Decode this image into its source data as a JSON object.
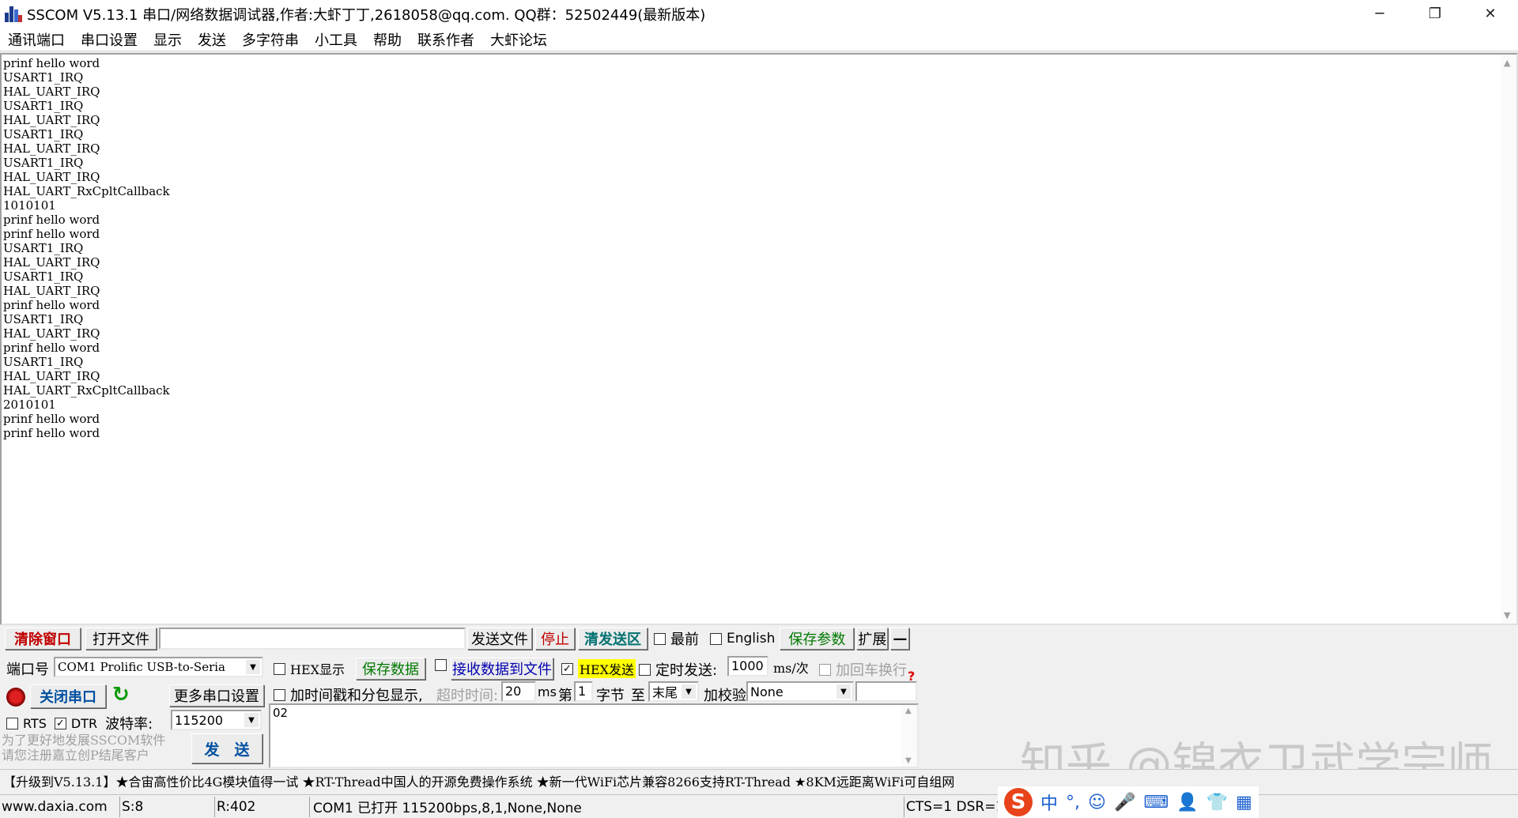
{
  "window": {
    "title": "SSCOM V5.13.1 串口/网络数据调试器,作者:大虾丁丁,2618058@qq.com. QQ群：52502449(最新版本)",
    "controls": [
      "─",
      "❐",
      "✕"
    ]
  },
  "menu": [
    "通讯端口",
    "串口设置",
    "显示",
    "发送",
    "多字符串",
    "小工具",
    "帮助",
    "联系作者",
    "大虾论坛"
  ],
  "receive": {
    "lines": [
      "prinf hello word",
      "USART1_IRQ",
      "HAL_UART_IRQ",
      "USART1_IRQ",
      "HAL_UART_IRQ",
      "USART1_IRQ",
      "HAL_UART_IRQ",
      "USART1_IRQ",
      "HAL_UART_IRQ",
      "HAL_UART_RxCpltCallback",
      "1010101",
      "prinf hello word",
      "prinf hello word",
      "USART1_IRQ",
      "HAL_UART_IRQ",
      "USART1_IRQ",
      "HAL_UART_IRQ",
      "prinf hello word",
      "USART1_IRQ",
      "HAL_UART_IRQ",
      "prinf hello word",
      "USART1_IRQ",
      "HAL_UART_IRQ",
      "HAL_UART_RxCpltCallback",
      "2010101",
      "prinf hello word",
      "prinf hello word"
    ]
  },
  "toolbar": {
    "clear": "清除窗口",
    "open_file": "打开文件",
    "file_path": "",
    "send_file": "发送文件",
    "stop": "停止",
    "clear_send": "清发送区",
    "top_most": "最前",
    "english": "English",
    "save_params": "保存参数",
    "expand": "扩展",
    "collapse": "—"
  },
  "port": {
    "port_label": "端口号",
    "port_value": "COM1 Prolific USB-to-Seria",
    "close_port": "关闭串口",
    "more_settings": "更多串口设置",
    "rts": "RTS",
    "dtr": "DTR",
    "baud_label": "波特率:",
    "baud_value": "115200"
  },
  "options": {
    "hex_display": "HEX显示",
    "save_data": "保存数据",
    "recv_to_file": "接收数据到文件",
    "hex_send": "HEX发送",
    "timed_send": "定时发送:",
    "interval": "1000",
    "interval_unit": "ms/次",
    "add_crlf": "加回车换行",
    "timestamp": "加时间戳和分包显示,",
    "timeout_label": "超时时间:",
    "timeout_value": "20",
    "timeout_unit": "ms",
    "nth": "第",
    "byte_index": "1",
    "byte_label": "字节",
    "to_label": "至",
    "to_value": "末尾",
    "checksum_label": "加校验",
    "checksum_value": "None"
  },
  "send": {
    "text": "02",
    "button": "发　送",
    "promo_line1": "为了更好地发展SSCOM软件",
    "promo_line2": "请您注册嘉立创P结尾客户"
  },
  "ticker": "【升级到V5.13.1】★合宙高性价比4G模块值得一试 ★RT-Thread中国人的开源免费操作系统 ★新一代WiFi芯片兼容8266支持RT-Thread ★8KM远距离WiFi可自组网",
  "status": {
    "site": "www.daxia.com",
    "sent": "S:8",
    "received": "R:402",
    "port_state": "COM1 已打开  115200bps,8,1,None,None",
    "lines": "CTS=1 DSR=1"
  },
  "watermark": "知乎 @锦衣卫武学宗师",
  "ime": {
    "logo": "S",
    "icons": [
      "中",
      "°,",
      "☺",
      "🎤",
      "⌨",
      "👤",
      "👕",
      "▦"
    ]
  },
  "colors": {
    "accent_red": "#c00000",
    "accent_teal": "#007070",
    "hex_send_bg": "#ffff00"
  }
}
